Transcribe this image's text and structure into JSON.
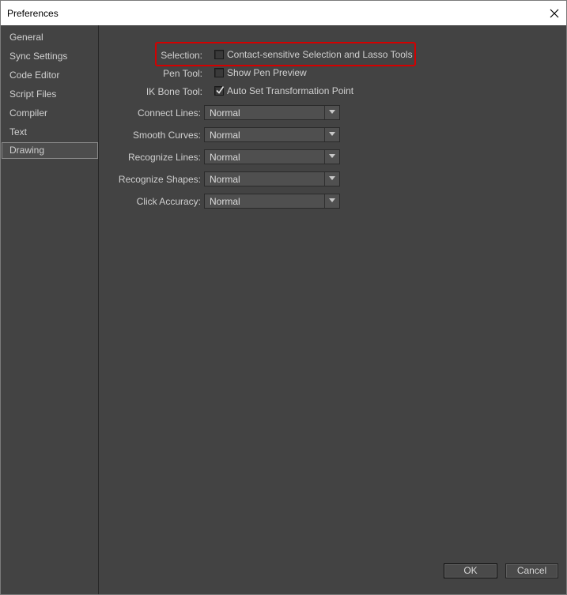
{
  "window": {
    "title": "Preferences"
  },
  "sidebar": {
    "items": [
      {
        "label": "General"
      },
      {
        "label": "Sync Settings"
      },
      {
        "label": "Code Editor"
      },
      {
        "label": "Script Files"
      },
      {
        "label": "Compiler"
      },
      {
        "label": "Text"
      },
      {
        "label": "Drawing",
        "selected": true
      }
    ]
  },
  "drawing": {
    "selection": {
      "label": "Selection:",
      "checkbox_label": "Contact-sensitive Selection and Lasso Tools",
      "checked": false
    },
    "pen_tool": {
      "label": "Pen Tool:",
      "checkbox_label": "Show Pen Preview",
      "checked": false
    },
    "ik_bone_tool": {
      "label": "IK Bone Tool:",
      "checkbox_label": "Auto Set Transformation Point",
      "checked": true
    },
    "connect_lines": {
      "label": "Connect Lines:",
      "value": "Normal"
    },
    "smooth_curves": {
      "label": "Smooth Curves:",
      "value": "Normal"
    },
    "recognize_lines": {
      "label": "Recognize Lines:",
      "value": "Normal"
    },
    "recognize_shapes": {
      "label": "Recognize Shapes:",
      "value": "Normal"
    },
    "click_accuracy": {
      "label": "Click Accuracy:",
      "value": "Normal"
    }
  },
  "footer": {
    "ok_label": "OK",
    "cancel_label": "Cancel"
  },
  "colors": {
    "panel_bg": "#434343",
    "highlight_border": "#d40000",
    "text": "#d0d0d0"
  }
}
